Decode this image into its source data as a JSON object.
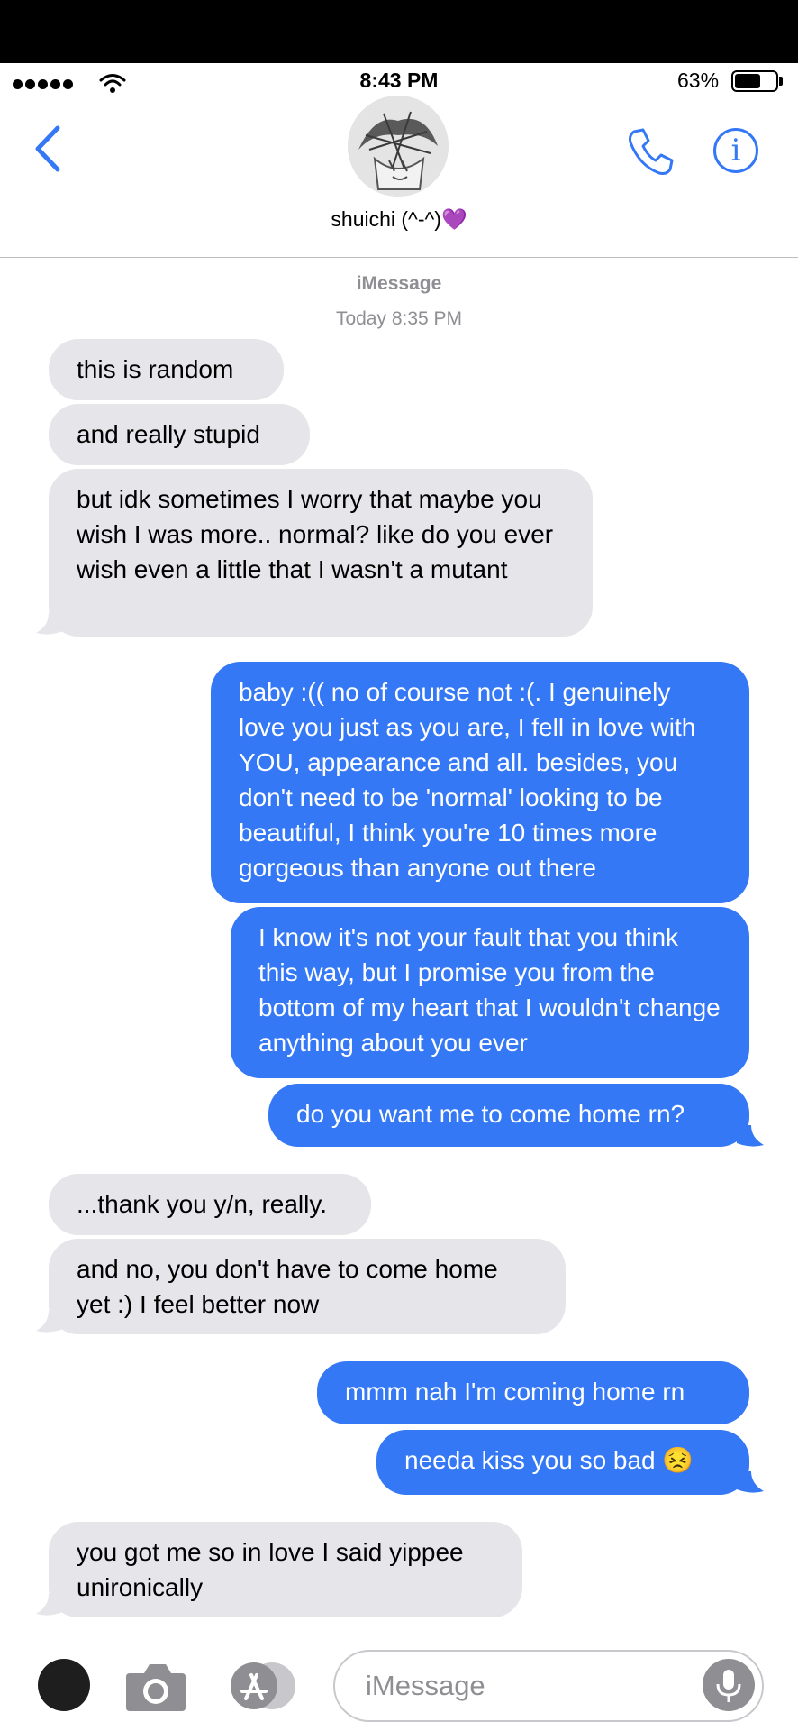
{
  "status_bar": {
    "time": "8:43 PM",
    "battery_percent": "63%",
    "battery_level": 0.63,
    "signal_bars": 5
  },
  "header": {
    "contact_name": "shuichi (^-^)💜"
  },
  "thread": {
    "service": "iMessage",
    "timestamp": "Today 8:35 PM"
  },
  "messages": [
    {
      "from": "them",
      "text": "this is random"
    },
    {
      "from": "them",
      "text": "and really stupid"
    },
    {
      "from": "them",
      "text": "but idk sometimes I worry that maybe you wish I was more.. normal? like do you ever wish even a little that I wasn't a mutant"
    },
    {
      "from": "me",
      "text": "baby :(( no of course not :(. I genuinely love you just as you are, I fell in love with YOU, appearance and all. besides, you don't need to be 'normal' looking to be beautiful, I think you're 10 times more gorgeous than anyone out there"
    },
    {
      "from": "me",
      "text": "I know it's not your fault that you think this way, but I promise you from the bottom of my heart that I wouldn't change anything about you ever"
    },
    {
      "from": "me",
      "text": "do you want me to come home rn?"
    },
    {
      "from": "them",
      "text": "...thank you y/n, really."
    },
    {
      "from": "them",
      "text": "and no, you don't have to come home yet :) I feel better now"
    },
    {
      "from": "me",
      "text": "mmm nah I'm coming home rn"
    },
    {
      "from": "me",
      "text": "needa kiss you so bad 😣"
    },
    {
      "from": "them",
      "text": "you got me so in love I said yippee unironically"
    }
  ],
  "composer": {
    "placeholder": "iMessage"
  },
  "colors": {
    "outgoing": "#3478f6",
    "incoming": "#e5e5ea",
    "accent": "#3478f6",
    "meta_text": "#8e8e93"
  },
  "icons": [
    "back-chevron-icon",
    "phone-icon",
    "info-icon",
    "camera-icon",
    "app-store-icon",
    "microphone-icon"
  ]
}
